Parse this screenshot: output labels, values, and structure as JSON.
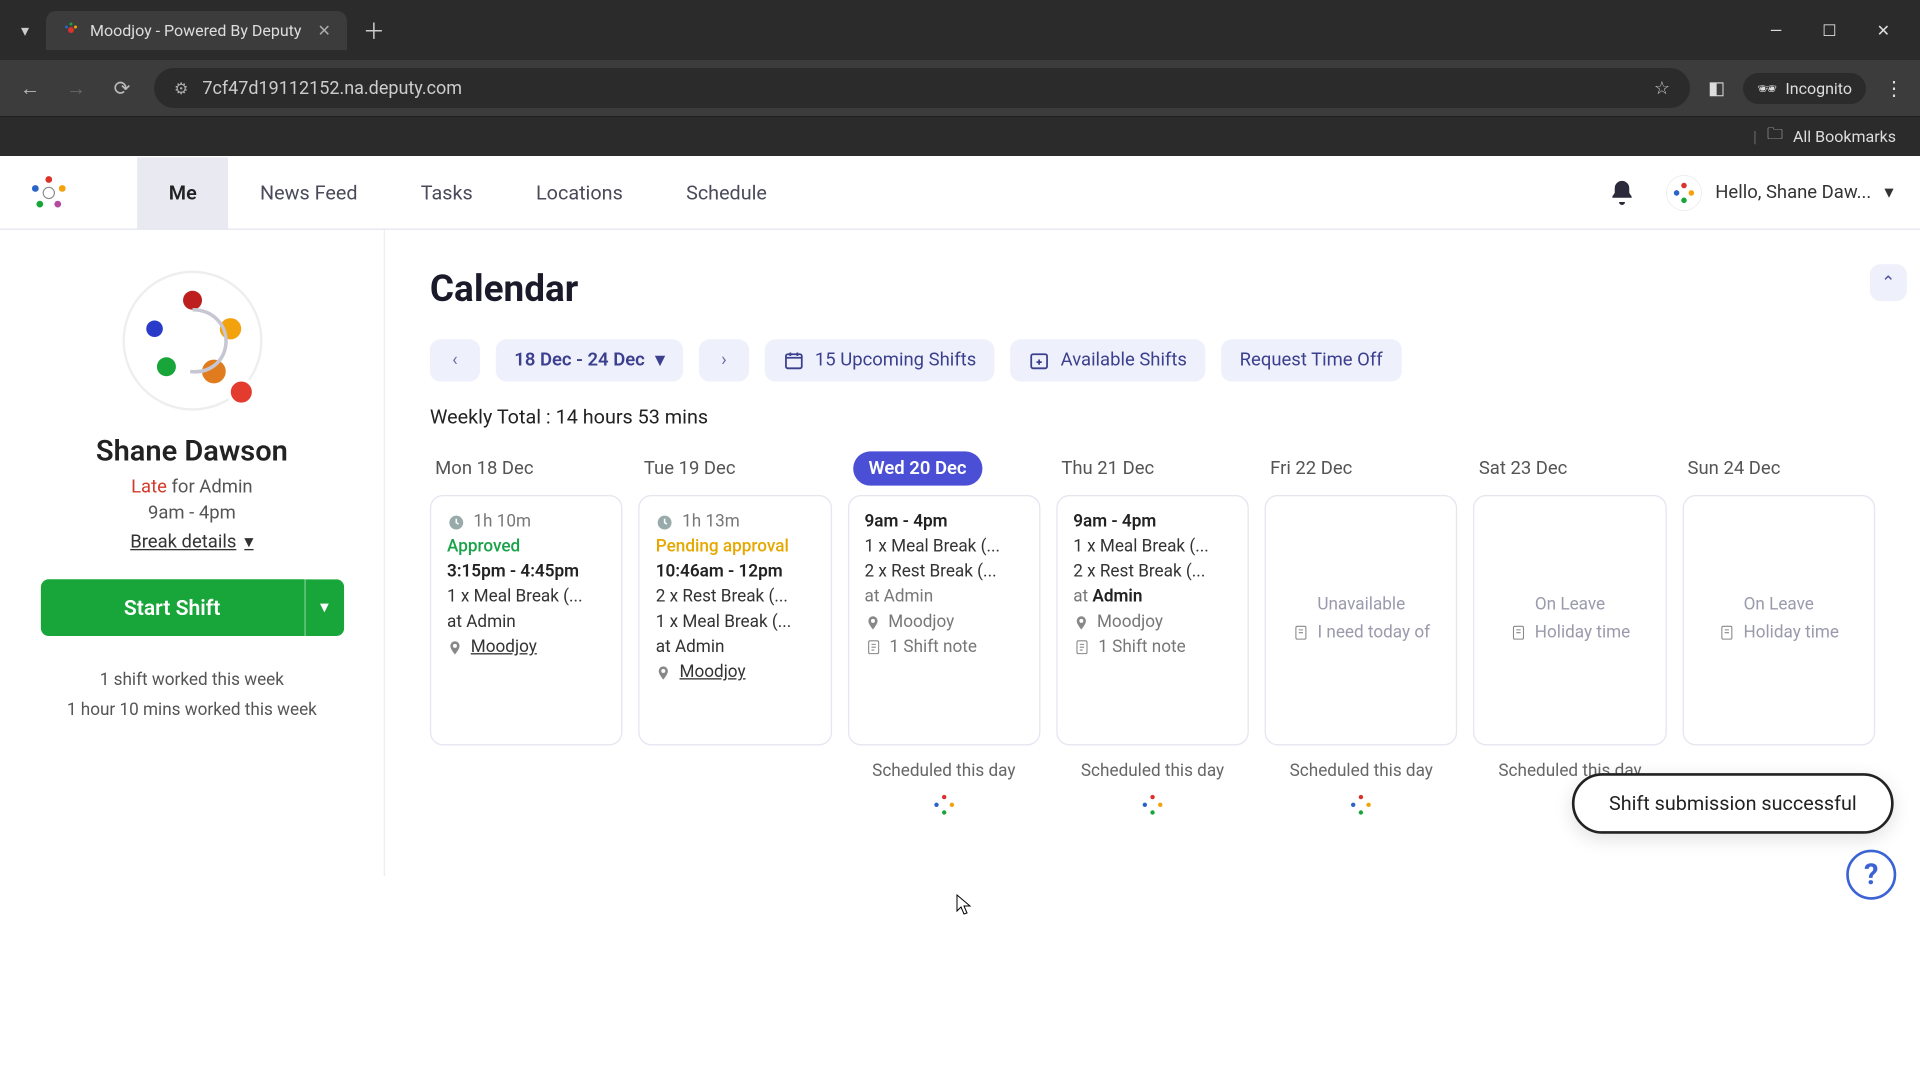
{
  "browser": {
    "tab_title": "Moodjoy - Powered By Deputy",
    "url": "7cf47d19112152.na.deputy.com",
    "incognito_label": "Incognito",
    "all_bookmarks": "All Bookmarks"
  },
  "nav": {
    "items": [
      "Me",
      "News Feed",
      "Tasks",
      "Locations",
      "Schedule"
    ],
    "greeting": "Hello, Shane Daw..."
  },
  "sidebar": {
    "user_name": "Shane Dawson",
    "status_late": "Late",
    "status_rest": " for Admin",
    "shift_time": "9am - 4pm",
    "break_details": "Break details",
    "start_shift": "Start Shift",
    "stat1": "1 shift worked this week",
    "stat2": "1 hour 10 mins worked this week"
  },
  "calendar": {
    "title": "Calendar",
    "range": "18 Dec - 24 Dec",
    "upcoming": "15 Upcoming Shifts",
    "available": "Available Shifts",
    "request_off": "Request Time Off",
    "weekly_total_label": "Weekly Total :",
    "weekly_total_value": " 14 hours 53 mins",
    "days": [
      "Mon 18 Dec",
      "Tue 19 Dec",
      "Wed 20 Dec",
      "Thu 21 Dec",
      "Fri 22 Dec",
      "Sat 23 Dec",
      "Sun 24 Dec"
    ],
    "active_day_index": 2,
    "cards": [
      {
        "dur": "1h 10m",
        "status": "Approved",
        "status_class": "approved",
        "time": "3:15pm - 4:45pm",
        "meal": "1 x Meal Break (...",
        "at": "at Admin",
        "loc": "Moodjoy"
      },
      {
        "dur": "1h 13m",
        "status": "Pending approval",
        "status_class": "pending",
        "time": "10:46am - 12pm",
        "rest": "2 x Rest Break (...",
        "meal": "1 x Meal Break (...",
        "at": "at Admin",
        "loc": "Moodjoy"
      },
      {
        "time": "9am - 4pm",
        "meal": "1 x Meal Break (...",
        "rest": "2 x Rest Break (...",
        "at_plain": "at Admin",
        "loc_plain": "Moodjoy",
        "note": "1 Shift note"
      },
      {
        "time": "9am - 4pm",
        "meal": "1 x Meal Break (...",
        "rest": "2 x Rest Break (...",
        "at_prefix": "at ",
        "at_bold": "Admin",
        "loc_plain": "Moodjoy",
        "note": "1 Shift note"
      },
      {
        "empty_title": "Unavailable",
        "empty_sub": "I need today of"
      },
      {
        "empty_title": "On Leave",
        "empty_sub": "Holiday time"
      },
      {
        "empty_title": "On Leave",
        "empty_sub": "Holiday time"
      }
    ],
    "scheduled_label": "Scheduled this day",
    "toast": "Shift submission successful"
  }
}
